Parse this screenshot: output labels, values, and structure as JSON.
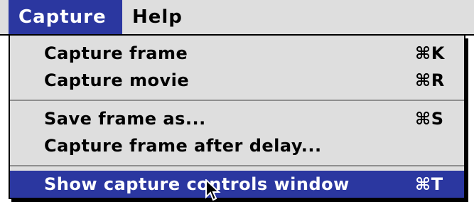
{
  "menubar": {
    "items": [
      {
        "label": "Capture",
        "active": true
      },
      {
        "label": "Help",
        "active": false
      }
    ]
  },
  "menu": {
    "items": [
      {
        "label": "Capture frame",
        "shortcut": "⌘K"
      },
      {
        "label": "Capture movie",
        "shortcut": "⌘R"
      },
      {
        "label": "Save frame as...",
        "shortcut": "⌘S"
      },
      {
        "label": "Capture frame after delay...",
        "shortcut": ""
      },
      {
        "label": "Show capture controls window",
        "shortcut": "⌘T",
        "highlighted": true
      }
    ]
  },
  "colors": {
    "highlight": "#2b37a0",
    "menu_background": "#dedede",
    "separator": "#8e8e8e"
  },
  "icons": {
    "cursor": "arrow-cursor-icon"
  }
}
